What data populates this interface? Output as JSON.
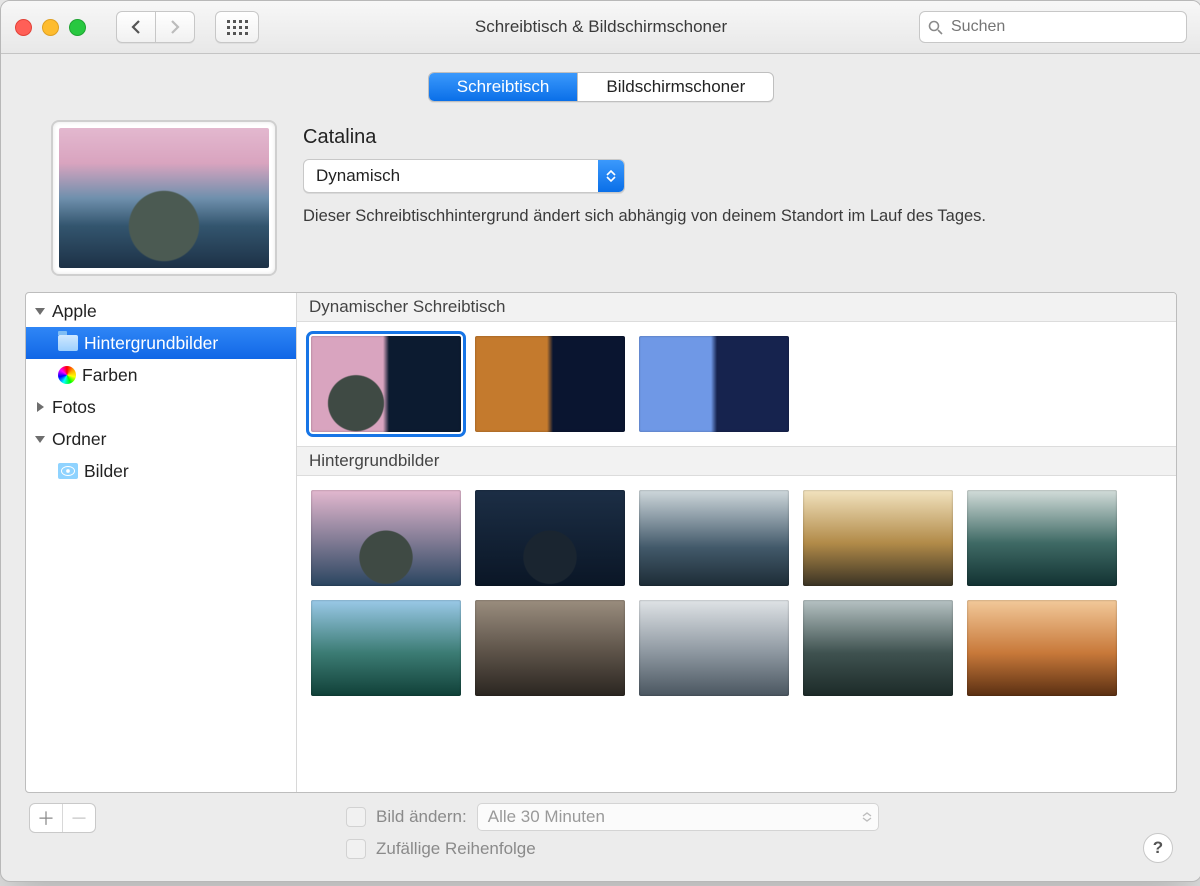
{
  "window": {
    "title": "Schreibtisch & Bildschirmschoner",
    "search_placeholder": "Suchen"
  },
  "tabs": {
    "desktop": "Schreibtisch",
    "screensaver": "Bildschirmschoner"
  },
  "current": {
    "name": "Catalina",
    "mode": "Dynamisch",
    "description": "Dieser Schreibtischhintergrund ändert sich abhängig von deinem Standort im Lauf des Tages."
  },
  "sidebar": {
    "apple": "Apple",
    "wallpapers": "Hintergrundbilder",
    "colors": "Farben",
    "photos": "Fotos",
    "folders": "Ordner",
    "pictures": "Bilder"
  },
  "sections": {
    "dynamic": "Dynamischer Schreibtisch",
    "still": "Hintergrundbilder"
  },
  "footer": {
    "change_picture": "Bild ändern:",
    "interval": "Alle 30 Minuten",
    "random": "Zufällige Reihenfolge",
    "plus": "＋",
    "minus": "－",
    "help": "?"
  }
}
